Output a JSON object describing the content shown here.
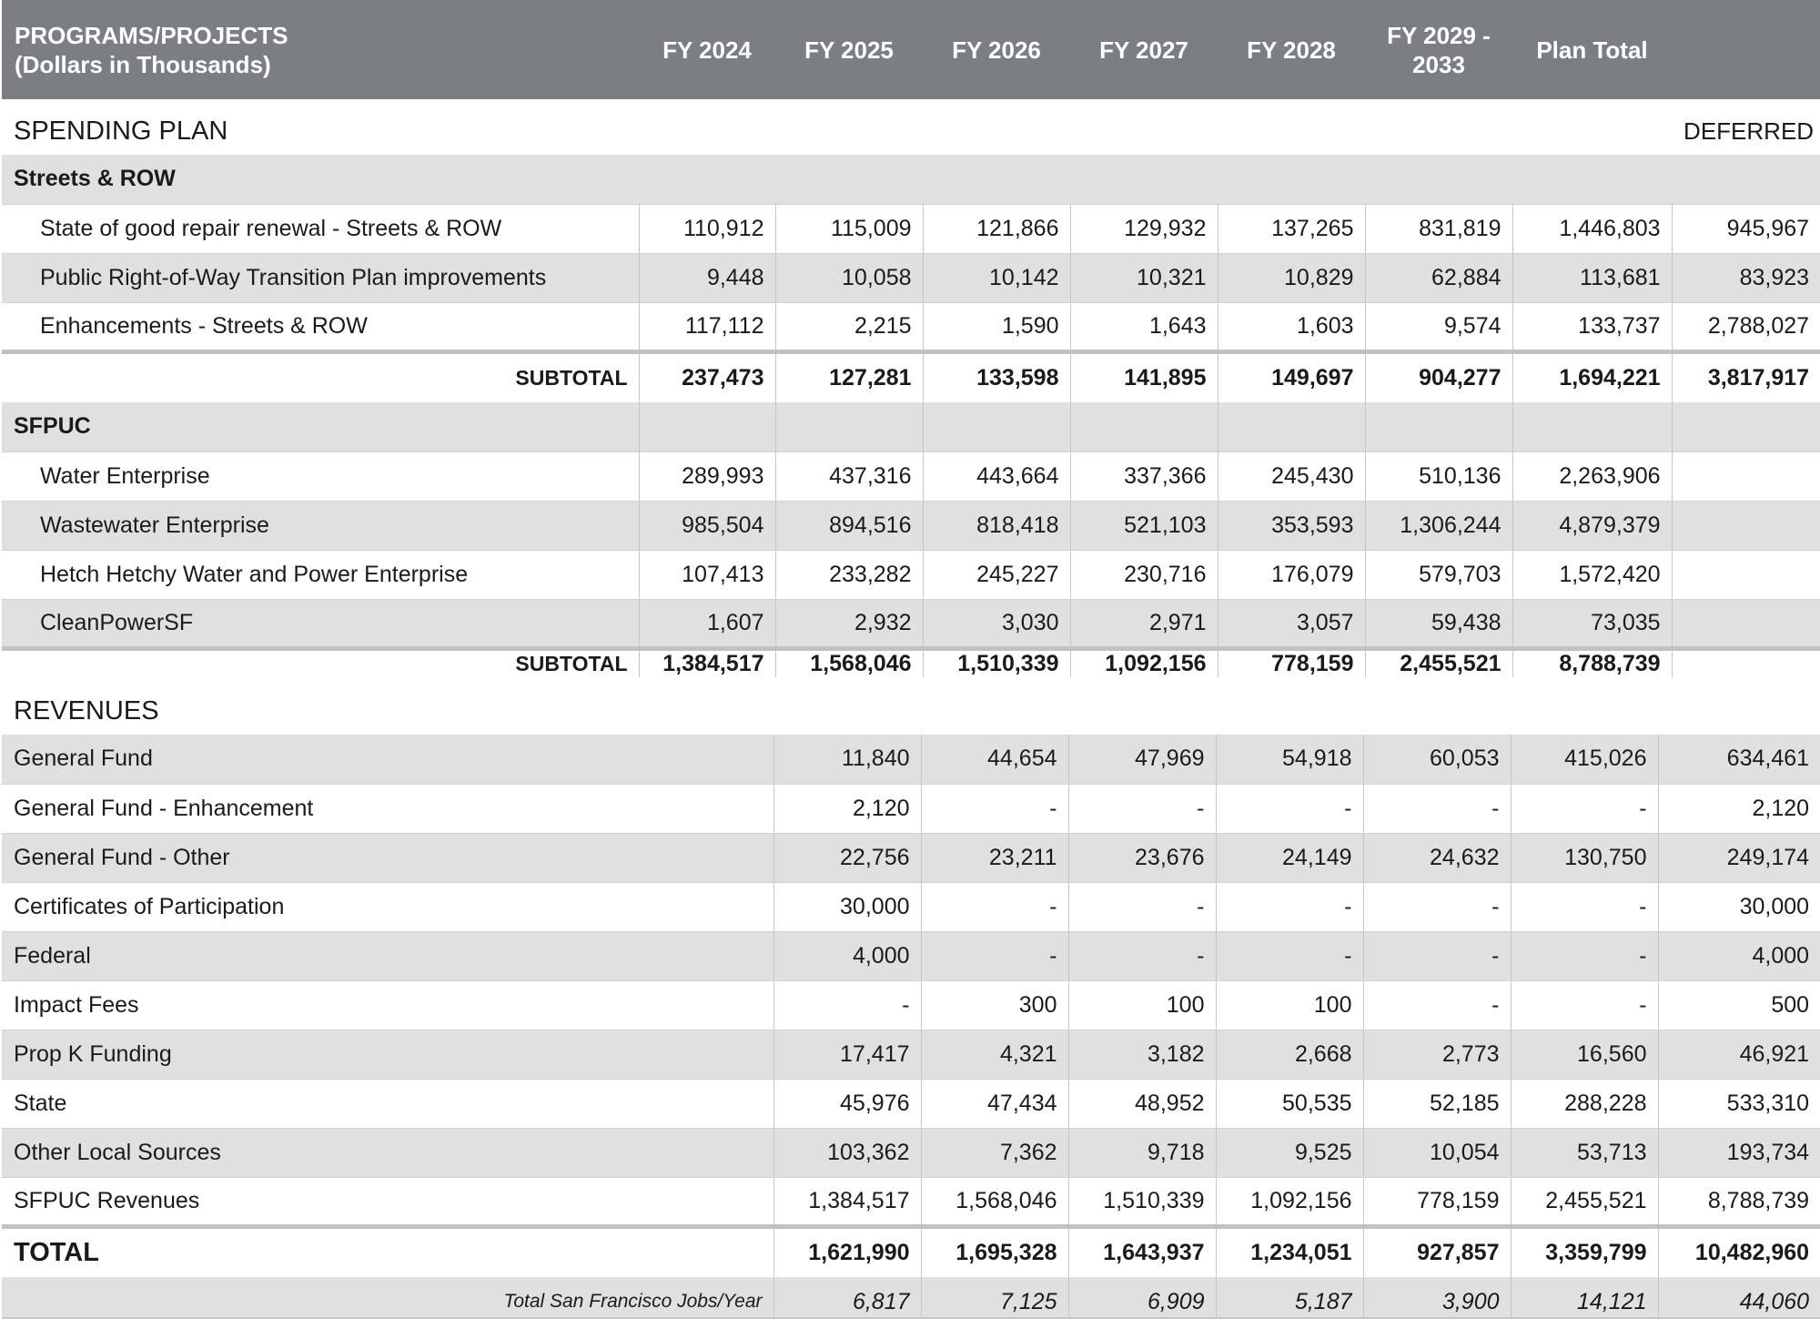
{
  "header": {
    "programs_line1": "PROGRAMS/PROJECTS",
    "programs_line2": "(Dollars in Thousands)",
    "fy2024": "FY 2024",
    "fy2025": "FY 2025",
    "fy2026": "FY 2026",
    "fy2027": "FY 2027",
    "fy2028": "FY 2028",
    "fy2029_line1": "FY 2029 -",
    "fy2029_line2": "2033",
    "plan_total": "Plan Total"
  },
  "spending": {
    "title": "SPENDING PLAN",
    "deferred_label": "DEFERRED",
    "streets": {
      "group": "Streets & ROW",
      "rows": [
        {
          "label": "State of good repair renewal - Streets & ROW",
          "values": [
            "110,912",
            "115,009",
            "121,866",
            "129,932",
            "137,265",
            "831,819",
            "1,446,803",
            "945,967"
          ]
        },
        {
          "label": "Public Right-of-Way Transition Plan improvements",
          "values": [
            "9,448",
            "10,058",
            "10,142",
            "10,321",
            "10,829",
            "62,884",
            "113,681",
            "83,923"
          ]
        },
        {
          "label": "Enhancements - Streets & ROW",
          "values": [
            "117,112",
            "2,215",
            "1,590",
            "1,643",
            "1,603",
            "9,574",
            "133,737",
            "2,788,027"
          ]
        }
      ],
      "subtotal_label": "SUBTOTAL",
      "subtotal": [
        "237,473",
        "127,281",
        "133,598",
        "141,895",
        "149,697",
        "904,277",
        "1,694,221",
        "3,817,917"
      ]
    },
    "sfpuc": {
      "group": "SFPUC",
      "rows": [
        {
          "label": "Water Enterprise",
          "values": [
            "289,993",
            "437,316",
            "443,664",
            "337,366",
            "245,430",
            "510,136",
            "2,263,906",
            ""
          ]
        },
        {
          "label": "Wastewater Enterprise",
          "values": [
            "985,504",
            "894,516",
            "818,418",
            "521,103",
            "353,593",
            "1,306,244",
            "4,879,379",
            ""
          ]
        },
        {
          "label": "Hetch Hetchy Water and Power Enterprise",
          "values": [
            "107,413",
            "233,282",
            "245,227",
            "230,716",
            "176,079",
            "579,703",
            "1,572,420",
            ""
          ]
        },
        {
          "label": "CleanPowerSF",
          "values": [
            "1,607",
            "2,932",
            "3,030",
            "2,971",
            "3,057",
            "59,438",
            "73,035",
            ""
          ]
        }
      ],
      "subtotal_label": "SUBTOTAL",
      "subtotal": [
        "1,384,517",
        "1,568,046",
        "1,510,339",
        "1,092,156",
        "778,159",
        "2,455,521",
        "8,788,739",
        ""
      ]
    }
  },
  "revenues": {
    "title": "REVENUES",
    "rows": [
      {
        "label": "General Fund",
        "values": [
          "11,840",
          "44,654",
          "47,969",
          "54,918",
          "60,053",
          "415,026",
          "634,461"
        ]
      },
      {
        "label": "General Fund - Enhancement",
        "values": [
          "2,120",
          "-",
          "-",
          "-",
          "-",
          "-",
          "2,120"
        ]
      },
      {
        "label": "General Fund - Other",
        "values": [
          "22,756",
          "23,211",
          "23,676",
          "24,149",
          "24,632",
          "130,750",
          "249,174"
        ]
      },
      {
        "label": "Certificates of Participation",
        "values": [
          "30,000",
          "-",
          "-",
          "-",
          "-",
          "-",
          "30,000"
        ]
      },
      {
        "label": "Federal",
        "values": [
          "4,000",
          "-",
          "-",
          "-",
          "-",
          "-",
          "4,000"
        ]
      },
      {
        "label": "Impact Fees",
        "values": [
          "-",
          "300",
          "100",
          "100",
          "-",
          "-",
          "500"
        ]
      },
      {
        "label": "Prop K Funding",
        "values": [
          "17,417",
          "4,321",
          "3,182",
          "2,668",
          "2,773",
          "16,560",
          "46,921"
        ]
      },
      {
        "label": "State",
        "values": [
          "45,976",
          "47,434",
          "48,952",
          "50,535",
          "52,185",
          "288,228",
          "533,310"
        ]
      },
      {
        "label": "Other Local Sources",
        "values": [
          "103,362",
          "7,362",
          "9,718",
          "9,525",
          "10,054",
          "53,713",
          "193,734"
        ]
      },
      {
        "label": "SFPUC Revenues",
        "values": [
          "1,384,517",
          "1,568,046",
          "1,510,339",
          "1,092,156",
          "778,159",
          "2,455,521",
          "8,788,739"
        ]
      }
    ],
    "total_label": "TOTAL",
    "total": [
      "1,621,990",
      "1,695,328",
      "1,643,937",
      "1,234,051",
      "927,857",
      "3,359,799",
      "10,482,960"
    ],
    "jobs_label": "Total San Francisco Jobs/Year",
    "jobs": [
      "6,817",
      "7,125",
      "6,909",
      "5,187",
      "3,900",
      "14,121",
      "44,060"
    ]
  }
}
